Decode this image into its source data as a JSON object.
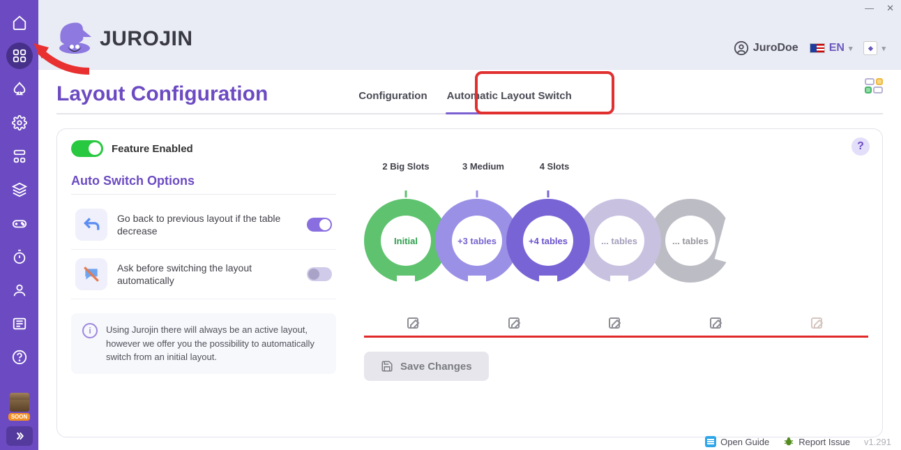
{
  "app_name": "JUROJIN",
  "user": {
    "name": "JuroDoe"
  },
  "lang": {
    "code": "EN"
  },
  "page": {
    "title": "Layout Configuration",
    "tabs": {
      "config": "Configuration",
      "auto": "Automatic Layout Switch"
    },
    "feature_toggle_label": "Feature Enabled",
    "section_title": "Auto Switch Options",
    "options": {
      "go_back": "Go back to previous layout if the table decrease",
      "ask": "Ask before switching the layout automatically"
    },
    "info_text": "Using Jurojin there will always be an active layout, however we offer you the possibility to automatically switch from an initial layout.",
    "ring_labels": {
      "r1": "2 Big Slots",
      "r2": "3 Medium",
      "r3": "4 Slots"
    },
    "ring_inner": {
      "r1": "Initial",
      "r2": "+3 tables",
      "r3": "+4 tables",
      "r4": "... tables",
      "r5": "... tables"
    },
    "save": "Save Changes"
  },
  "sidebar": {
    "soon": "SOON"
  },
  "footer": {
    "guide": "Open Guide",
    "report": "Report Issue",
    "version": "v1.291"
  }
}
